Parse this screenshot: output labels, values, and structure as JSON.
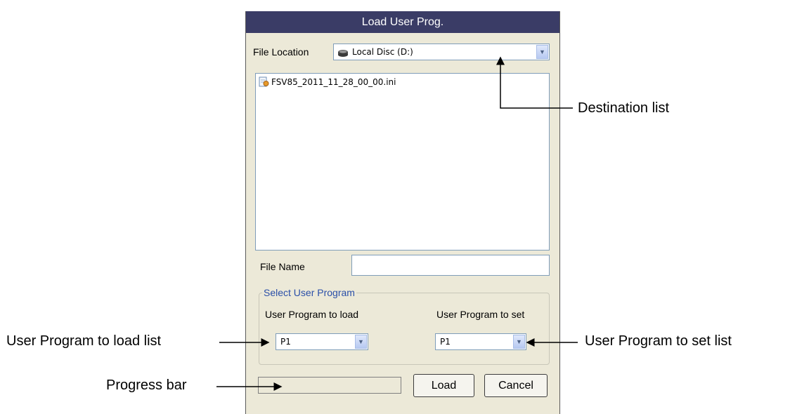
{
  "dialog": {
    "title": "Load User Prog.",
    "file_location_label": "File Location",
    "file_location_value": "Local Disc (D:)",
    "files": [
      "FSV85_2011_11_28_00_00.ini"
    ],
    "file_name_label": "File Name",
    "file_name_value": "",
    "group_title": "Select User Program",
    "load_label": "User Program to load",
    "load_value": "P1",
    "set_label": "User Program to set",
    "set_value": "P1",
    "load_button": "Load",
    "cancel_button": "Cancel",
    "progress_fraction": 0
  },
  "callouts": {
    "destination": "Destination list",
    "load_list": "User Program to load list",
    "set_list": "User Program to set list",
    "progress": "Progress bar"
  },
  "colors": {
    "titlebar": "#3a3c66",
    "dialog_bg": "#ece9d8",
    "group_title": "#2a4fa8"
  },
  "icons": {
    "drive": "hard-disk-icon",
    "file": "ini-file-icon",
    "dropdown": "chevron-down-icon"
  }
}
